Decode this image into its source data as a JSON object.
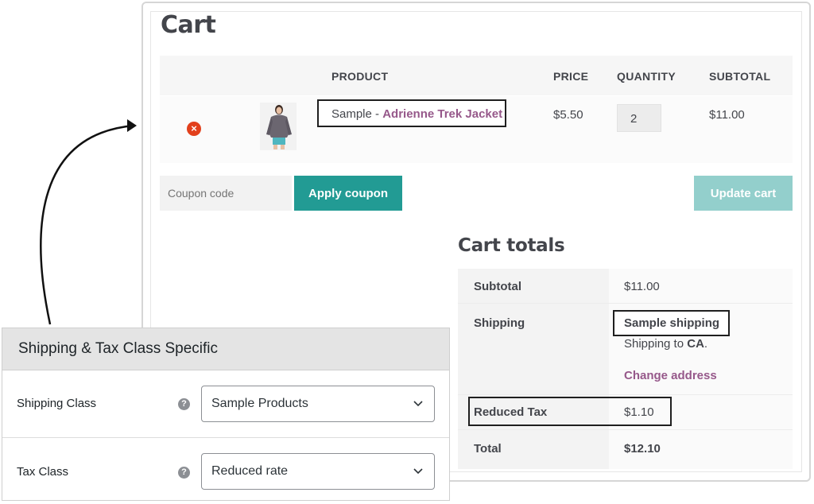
{
  "cart": {
    "title": "Cart",
    "columns": {
      "product": "PRODUCT",
      "price": "PRICE",
      "quantity": "QUANTITY",
      "subtotal": "SUBTOTAL"
    },
    "item": {
      "name_prefix": "Sample - ",
      "name_link": "Adrienne Trek Jacket",
      "price": "$5.50",
      "quantity": "2",
      "subtotal": "$11.00"
    },
    "coupon_placeholder": "Coupon code",
    "apply_coupon_label": "Apply coupon",
    "update_cart_label": "Update cart"
  },
  "totals": {
    "title": "Cart totals",
    "subtotal_label": "Subtotal",
    "subtotal_value": "$11.00",
    "shipping_label": "Shipping",
    "shipping_method": "Sample shipping",
    "shipping_to_prefix": "Shipping to ",
    "shipping_to_region": "CA",
    "shipping_to_suffix": ".",
    "change_address": "Change address",
    "tax_label": "Reduced Tax",
    "tax_value": "$1.10",
    "total_label": "Total",
    "total_value": "$12.10"
  },
  "settings": {
    "title": "Shipping & Tax Class Specific",
    "shipping_class_label": "Shipping Class",
    "shipping_class_value": "Sample Products",
    "tax_class_label": "Tax Class",
    "tax_class_value": "Reduced rate",
    "help_glyph": "?"
  },
  "icons": {
    "remove": "×"
  },
  "colors": {
    "accent": "#96588a",
    "primary_button": "#229b94",
    "disabled_button": "#93cfcc",
    "remove": "#e2401c"
  }
}
